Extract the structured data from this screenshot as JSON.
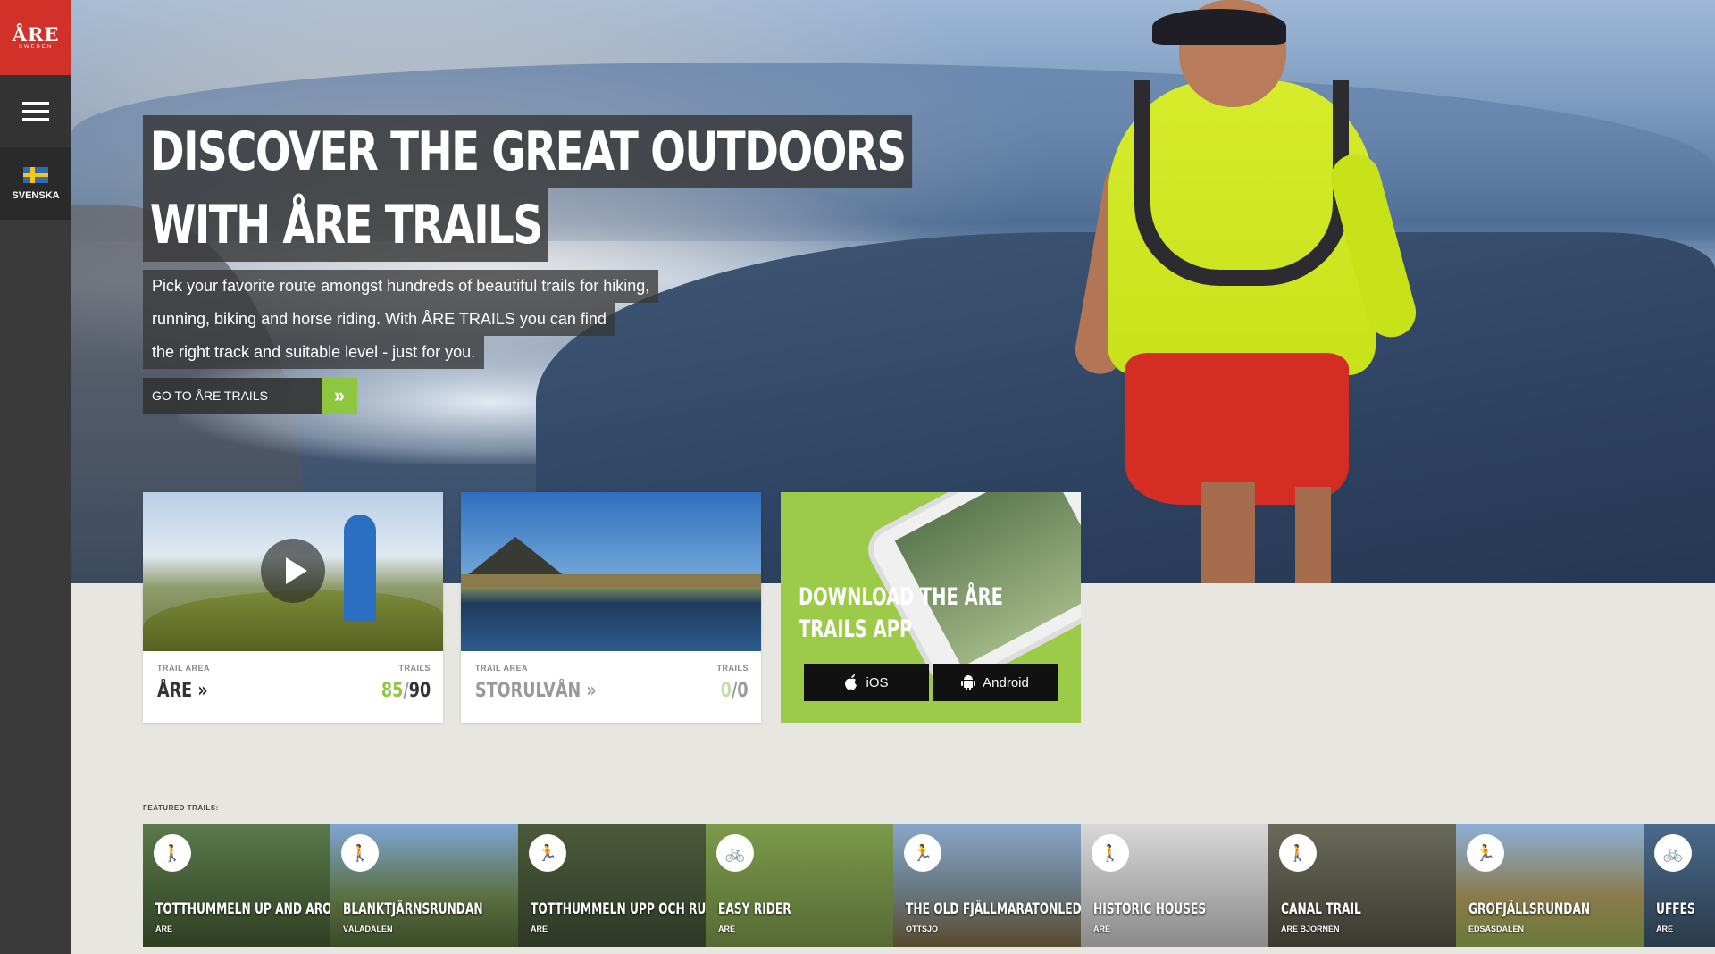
{
  "sidebar": {
    "logo_main": "ÅRE",
    "logo_sub": "SWEDEN",
    "language_label": "SVENSKA"
  },
  "hero": {
    "headline_line1": "DISCOVER THE GREAT OUTDOORS",
    "headline_line2": "WITH ÅRE TRAILS",
    "intro_line1": "Pick your favorite route amongst hundreds of beautiful trails for hiking,",
    "intro_line2": "running, biking and horse riding. With ÅRE TRAILS you can find",
    "intro_line3": "the right track and suitable level - just for you.",
    "cta_label": "GO TO ÅRE TRAILS"
  },
  "trail_areas": [
    {
      "area_label": "TRAIL AREA",
      "name": "ÅRE",
      "trails_label": "TRAILS",
      "count_open": "85",
      "count_total": "90"
    },
    {
      "area_label": "TRAIL AREA",
      "name": "STORULVÅN",
      "trails_label": "TRAILS",
      "count_open": "0",
      "count_total": "0"
    }
  ],
  "app_promo": {
    "title_line1": "DOWNLOAD THE ÅRE",
    "title_line2": "TRAILS APP",
    "ios_label": "iOS",
    "android_label": "Android"
  },
  "featured": {
    "label": "FEATURED TRAILS:",
    "items": [
      {
        "name": "TOTTHUMMELN UP AND AROUND",
        "location": "ÅRE",
        "icon": "hiking-icon"
      },
      {
        "name": "BLANKTJÄRNSRUNDAN",
        "location": "VÅLÅDALEN",
        "icon": "hiking-icon"
      },
      {
        "name": "TOTTHUMMELN UPP OCH RUNT",
        "location": "ÅRE",
        "icon": "running-icon"
      },
      {
        "name": "EASY RIDER",
        "location": "ÅRE",
        "icon": "biking-icon"
      },
      {
        "name": "THE OLD FJÄLLMARATONLEDEN",
        "location": "OTTSJÖ",
        "icon": "running-icon"
      },
      {
        "name": "HISTORIC HOUSES",
        "location": "ÅRE",
        "icon": "hiking-icon"
      },
      {
        "name": "CANAL TRAIL",
        "location": "ÅRE BJÖRNEN",
        "icon": "hiking-icon"
      },
      {
        "name": "GROFJÄLLSRUNDAN",
        "location": "EDSÅSDALEN",
        "icon": "running-icon"
      },
      {
        "name": "UFFES",
        "location": "ÅRE",
        "icon": "biking-icon"
      }
    ]
  },
  "colors": {
    "brand_red": "#d2312a",
    "accent_green": "#8dc63f",
    "app_green": "#9ccb4a"
  }
}
